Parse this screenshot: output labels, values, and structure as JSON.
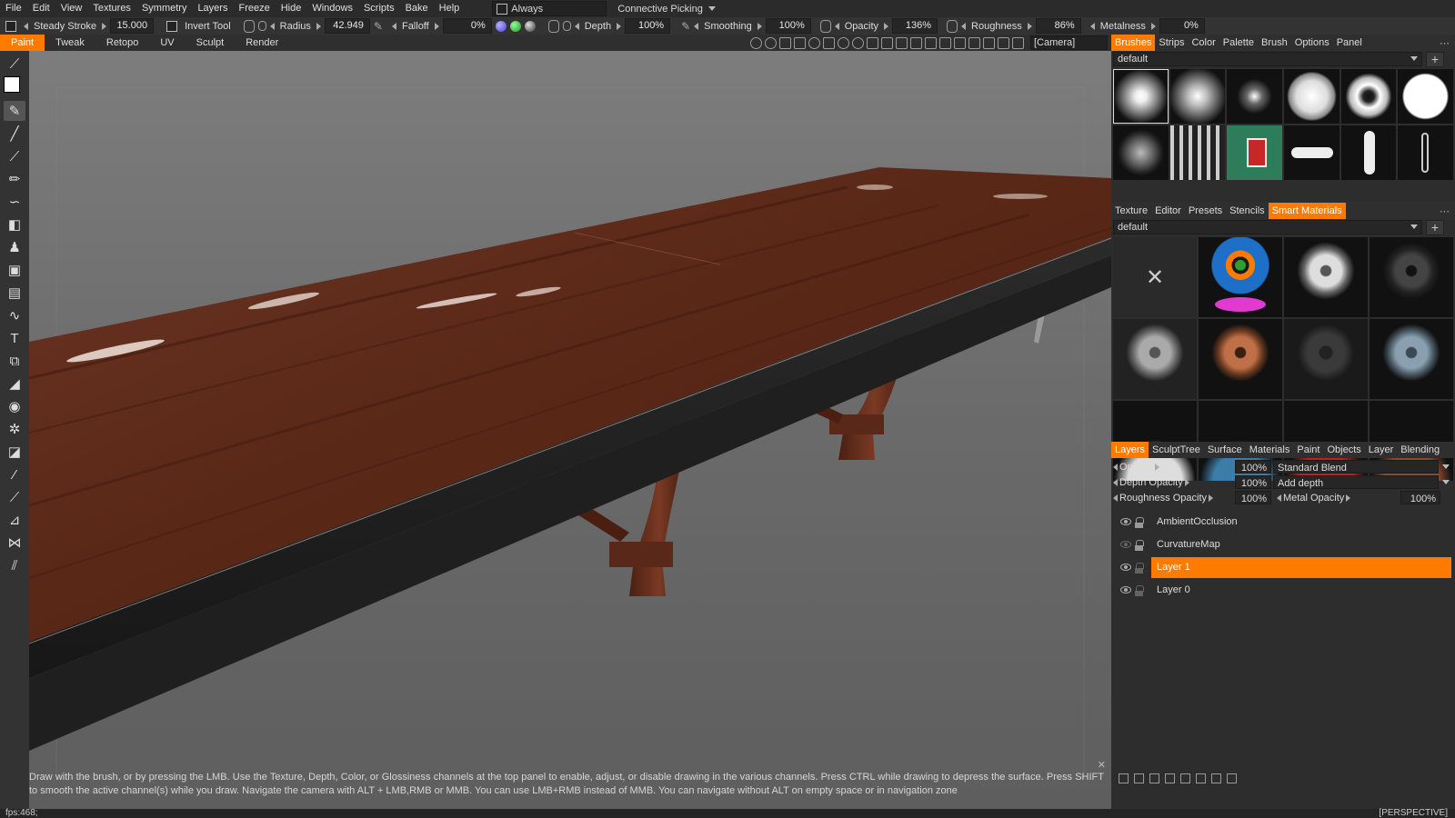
{
  "menu": {
    "items": [
      "File",
      "Edit",
      "View",
      "Textures",
      "Symmetry",
      "Layers",
      "Freeze",
      "Hide",
      "Windows",
      "Scripts",
      "Bake",
      "Help"
    ],
    "always_label": "Always",
    "picking_label": "Connective Picking"
  },
  "tool_options": {
    "steady_stroke_label": "Steady Stroke",
    "steady_stroke_value": "15.000",
    "invert_tool_label": "Invert Tool",
    "radius_label": "Radius",
    "radius_value": "42.949",
    "falloff_label": "Falloff",
    "falloff_value": "0%",
    "depth_label": "Depth",
    "depth_value": "100%",
    "smoothing_label": "Smoothing",
    "smoothing_value": "100%",
    "opacity_label": "Opacity",
    "opacity_value": "136%",
    "roughness_label": "Roughness",
    "roughness_value": "86%",
    "metalness_label": "Metalness",
    "metalness_value": "0%"
  },
  "rooms": {
    "tabs": [
      "Paint",
      "Tweak",
      "Retopo",
      "UV",
      "Sculpt",
      "Render"
    ],
    "active": "Paint",
    "camera_value": "[Camera]"
  },
  "brush_panel": {
    "tabs": [
      "Brushes",
      "Strips",
      "Color",
      "Palette",
      "Brush",
      "Options",
      "Panel"
    ],
    "active": "Brushes",
    "preset": "default"
  },
  "materials_panel": {
    "tabs": [
      "Texture",
      "Editor",
      "Presets",
      "Stencils",
      "Smart Materials"
    ],
    "active": "Smart Materials",
    "preset": "default"
  },
  "layers_panel": {
    "tabs": [
      "Layers",
      "SculptTree",
      "Surface",
      "Materials",
      "Paint",
      "Objects",
      "Layer",
      "Blending"
    ],
    "active": "Layers",
    "opacity_label": "Opacity",
    "opacity_value": "100%",
    "blend_mode": "Standard Blend",
    "depth_opacity_label": "Depth Opacity",
    "depth_opacity_value": "100%",
    "depth_mode": "Add depth",
    "roughness_opacity_label": "Roughness Opacity",
    "roughness_opacity_value": "100%",
    "metal_opacity_label": "Metal Opacity",
    "metal_opacity_value": "100%",
    "layers": [
      {
        "name": "AmbientOcclusion",
        "visible": true
      },
      {
        "name": "CurvatureMap",
        "visible": false
      },
      {
        "name": "Layer 1",
        "visible": true,
        "selected": true
      },
      {
        "name": "Layer 0",
        "visible": true
      }
    ]
  },
  "hint_text": "Draw with the brush, or by pressing the LMB. Use the Texture, Depth, Color, or Glossiness channels at the top panel to enable, adjust, or disable drawing in the various channels. Press CTRL while drawing to depress the surface. Press SHIFT to smooth the active channel(s) while you draw. Navigate the camera with ALT + LMB,RMB or MMB. You can use LMB+RMB instead of MMB. You can navigate without ALT on empty space or in navigation zone",
  "status": {
    "fps": "fps:468;",
    "projection": "[PERSPECTIVE]"
  },
  "colors": {
    "accent": "#ff7a00",
    "wood": "#5a2818"
  }
}
